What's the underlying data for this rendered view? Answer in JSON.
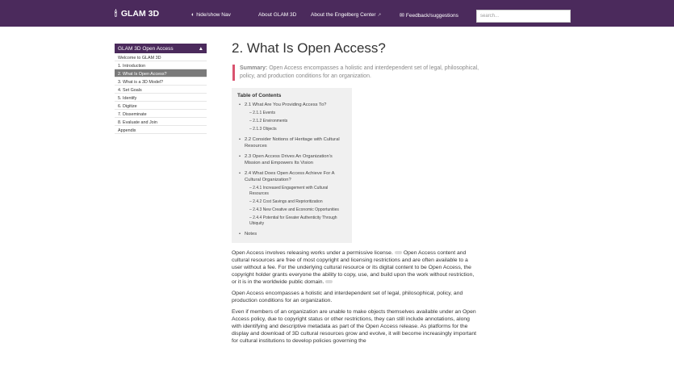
{
  "header": {
    "brand": "GLAM 3D",
    "nav": [
      {
        "label": "hide/show Nav"
      },
      {
        "label": "About GLAM 3D"
      },
      {
        "label": "About the Engelberg Center"
      },
      {
        "label": "Feedback/suggestions"
      }
    ],
    "search_placeholder": "search..."
  },
  "sidebar": {
    "title": "GLAM 3D Open Access",
    "items": [
      {
        "label": "Welcome to GLAM 3D"
      },
      {
        "label": "1. Introduction"
      },
      {
        "label": "2. What Is Open Access?",
        "active": true
      },
      {
        "label": "3. What is a 3D Model?"
      },
      {
        "label": "4. Set Goals"
      },
      {
        "label": "5. Identify"
      },
      {
        "label": "6. Digitize"
      },
      {
        "label": "7. Disseminate"
      },
      {
        "label": "8. Evaluate and Join"
      },
      {
        "label": "Appendix"
      }
    ]
  },
  "main": {
    "title": "2. What Is Open Access?",
    "summary_label": "Summary:",
    "summary_text": "Open Access encompasses a holistic and interdependent set of legal, philosophical, policy, and production conditions for an organization.",
    "toc": {
      "title": "Table of Contents",
      "items": [
        {
          "label": "2.1 What Are You Providing Access To?",
          "level": 1
        },
        {
          "label": "– 2.1.1 Events",
          "level": 2
        },
        {
          "label": "– 2.1.2 Environments",
          "level": 2
        },
        {
          "label": "– 2.1.3 Objects",
          "level": 2
        },
        {
          "label": "2.2 Consider Notions of Heritage with Cultural Resources",
          "level": 1
        },
        {
          "label": "2.3 Open Access Drives An Organization's Mission and Empowers Its Vision",
          "level": 1
        },
        {
          "label": "2.4 What Does Open Access Achieve For A Cultural Organization?",
          "level": 1
        },
        {
          "label": "– 2.4.1 Increased Engagement with Cultural Resources",
          "level": 2
        },
        {
          "label": "– 2.4.2 Cost Savings and Reprioritization",
          "level": 2
        },
        {
          "label": "– 2.4.3 New Creative and Economic Opportunities",
          "level": 2
        },
        {
          "label": "– 2.4.4 Potential for Greater Authenticity Through Ubiquity",
          "level": 2
        },
        {
          "label": "Notes",
          "level": 1
        }
      ]
    },
    "p1_a": "Open Access involves releasing works under a permissive license.",
    "p1_b": "Open Access content and cultural resources are free of most copyright and licensing restrictions and are often available to a user without a fee. For the underlying cultural resource or its digital content to be Open Access, the copyright holder grants everyone the ability to copy, use, and build upon the work without restriction, or it is in the worldwide public domain.",
    "p2": "Open Access encompasses a holistic and interdependent set of legal, philosophical, policy, and production conditions for an organization.",
    "p3": "Even if members of an organization are unable to make objects themselves available under an Open Access policy, due to copyright status or other restrictions, they can still include annotations, along with identifying and descriptive metadata as part of the Open Access release. As platforms for the display and download of 3D cultural resources grow and evolve, it will become increasingly important for cultural institutions to develop policies governing the"
  }
}
